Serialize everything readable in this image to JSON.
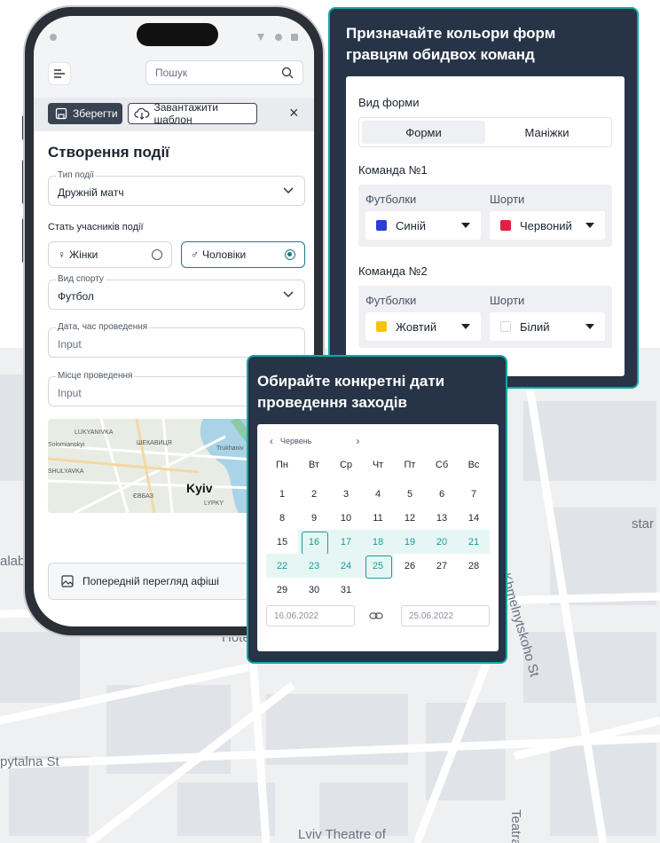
{
  "map": {
    "streets": [
      "Bohdana Khmelnytskoho St",
      "Lviv Theatre of",
      "pytalna St",
      "Teatra",
      "star",
      "Hote",
      "alab"
    ]
  },
  "phone": {
    "search_placeholder": "Пошук",
    "toolbar": {
      "save_label": "Зберегти",
      "template_label": "Завантажити шаблон"
    },
    "form_title": "Створення події",
    "event_type": {
      "label": "Тип події",
      "value": "Дружній матч"
    },
    "gender": {
      "label": "Стать учасників події",
      "options": [
        {
          "label": "Жінки",
          "selected": false
        },
        {
          "label": "Чоловіки",
          "selected": true
        }
      ]
    },
    "sport": {
      "label": "Вид спорту",
      "value": "Футбол"
    },
    "datetime": {
      "label": "Дата, час проведення",
      "placeholder": "Input"
    },
    "place": {
      "label": "Місце проведення",
      "placeholder": "Input"
    },
    "minimap_labels": [
      "LUKYANIVKA",
      "ШЕКАВИЦЯ",
      "Kyiv",
      "LYPKY",
      "ЄВБАЗ",
      "Trukhaniv",
      "SHULYAVKA",
      "Solomianskyi"
    ],
    "preview_label": "Попередній перегляд афіші"
  },
  "uniform_panel": {
    "title": "Призначайте кольори форм гравцям обидвох команд",
    "form_type_label": "Вид форми",
    "tabs": [
      {
        "label": "Форми",
        "active": true
      },
      {
        "label": "Маніжки",
        "active": false
      }
    ],
    "teams": [
      {
        "name": "Команда №1",
        "shirts_label": "Футболки",
        "shirts_color": "Синій",
        "shirts_hex": "#2b3ed6",
        "shorts_label": "Шорти",
        "shorts_color": "Червоний",
        "shorts_hex": "#e01f45"
      },
      {
        "name": "Команда №2",
        "shirts_label": "Футболки",
        "shirts_color": "Жовтий",
        "shirts_hex": "#f5c50b",
        "shorts_label": "Шорти",
        "shorts_color": "Білий",
        "shorts_hex": "#ffffff"
      }
    ]
  },
  "calendar_panel": {
    "title": "Обирайте конкретні дати проведення заходів",
    "month": "Червень",
    "weekdays": [
      "Пн",
      "Вт",
      "Ср",
      "Чт",
      "Пт",
      "Сб",
      "Вс"
    ],
    "weeks": [
      [
        "1",
        "2",
        "3",
        "4",
        "5",
        "6",
        "7"
      ],
      [
        "8",
        "9",
        "10",
        "11",
        "12",
        "13",
        "14"
      ],
      [
        "15",
        "16",
        "17",
        "18",
        "19",
        "20",
        "21"
      ],
      [
        "22",
        "23",
        "24",
        "25",
        "26",
        "27",
        "28"
      ],
      [
        "29",
        "30",
        "31",
        "",
        "",
        "",
        ""
      ]
    ],
    "range_start": "16",
    "range_end": "25",
    "range_days": [
      "16",
      "17",
      "18",
      "19",
      "20",
      "21",
      "22",
      "23",
      "24",
      "25"
    ],
    "start_date": "16.06.2022",
    "end_date": "25.06.2022"
  }
}
